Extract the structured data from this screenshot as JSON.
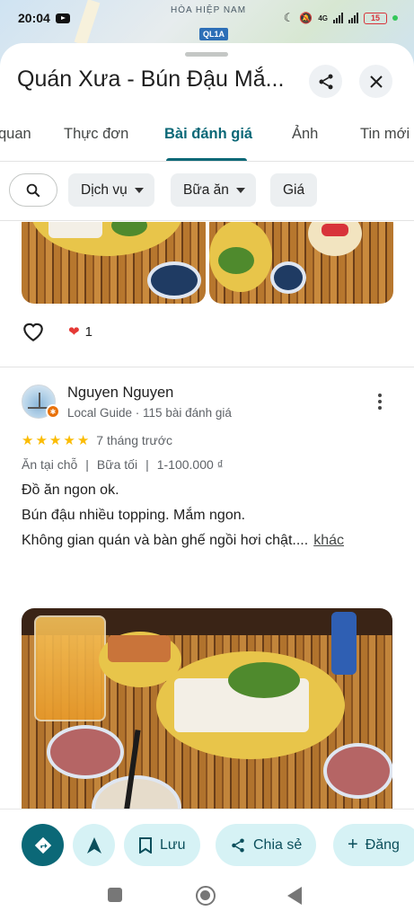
{
  "status_bar": {
    "time": "20:04",
    "map_label": "HÒA HIỆP NAM",
    "road_shield": "QL1A",
    "network_1": "4G",
    "battery": "15"
  },
  "header": {
    "title": "Quán Xưa - Bún Đậu Mắ..."
  },
  "tabs": [
    {
      "label": "quan"
    },
    {
      "label": "Thực đơn"
    },
    {
      "label": "Bài đánh giá"
    },
    {
      "label": "Ảnh"
    },
    {
      "label": "Tin mới"
    }
  ],
  "filters": {
    "chips": [
      {
        "label": "Dịch vụ"
      },
      {
        "label": "Bữa ăn"
      },
      {
        "label": "Giá"
      }
    ]
  },
  "prev_review": {
    "like_count": "1"
  },
  "review": {
    "name": "Nguyen Nguyen",
    "meta": "Local Guide · 115 bài đánh giá",
    "rating": 5,
    "time": "7 tháng trước",
    "tags": [
      "Ăn tại chỗ",
      "Bữa tối",
      "1-100.000 ₫"
    ],
    "lines": [
      "Đồ ăn ngon ok.",
      "Bún đậu nhiều topping. Mắm ngon.",
      "Không gian quán và bàn ghế ngồi hơi chật...."
    ],
    "more_label": "khác"
  },
  "actions": {
    "save": "Lưu",
    "share": "Chia sẻ",
    "post": "Đăng"
  },
  "colors": {
    "accent": "#0b6877",
    "pill_bg": "#d6f2f5",
    "star": "#fbbc04"
  }
}
